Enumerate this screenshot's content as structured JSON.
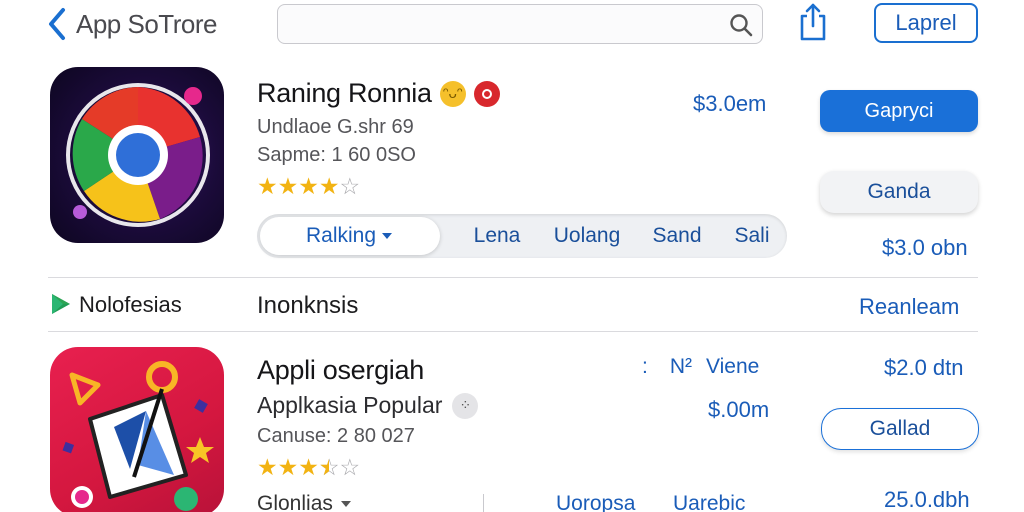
{
  "header": {
    "back_label": "App SoTrore",
    "search_placeholder": "",
    "right_button": "Laprel"
  },
  "app1": {
    "title": "Raning Ronnia",
    "line1": "Undlaoe G.shr 69",
    "line2": "Sapme: 1 60 0SO",
    "rating": 4,
    "rating_max": 5,
    "price_top": "$3.0em",
    "primary_button": "Gapryci",
    "secondary_button": "Ganda",
    "price_bottom": "$3.0 obn"
  },
  "tabs": {
    "active": "Ralking",
    "items": [
      "Lena",
      "Uolang",
      "Sand",
      "Sali"
    ]
  },
  "section": {
    "left_label": "Nolofesias",
    "middle_label": "Inonknsis",
    "right_link": "Reanleam"
  },
  "app2": {
    "title": "Appli osergiah",
    "subtitle": "Applkasia Popular",
    "line": "Canuse: 2 80 027",
    "rating": 3.5,
    "rating_max": 5,
    "meta_left": ":",
    "meta_mid": "N²",
    "meta_right": "Viene",
    "price_1": "$2.0 dtn",
    "price_2": "$.00m",
    "outline_button": "Gallad",
    "price_3": "25.0.dbh"
  },
  "bottom_row": {
    "dropdown": "Glonlias",
    "item1": "Uoropsa",
    "item2": "Uarebic"
  },
  "colors": {
    "accent": "#1a70d8",
    "link": "#1a5cb8",
    "star": "#f2b312"
  },
  "icons": [
    "chevron-left-icon",
    "search-icon",
    "share-icon",
    "play-store-icon",
    "chevron-down-icon"
  ]
}
